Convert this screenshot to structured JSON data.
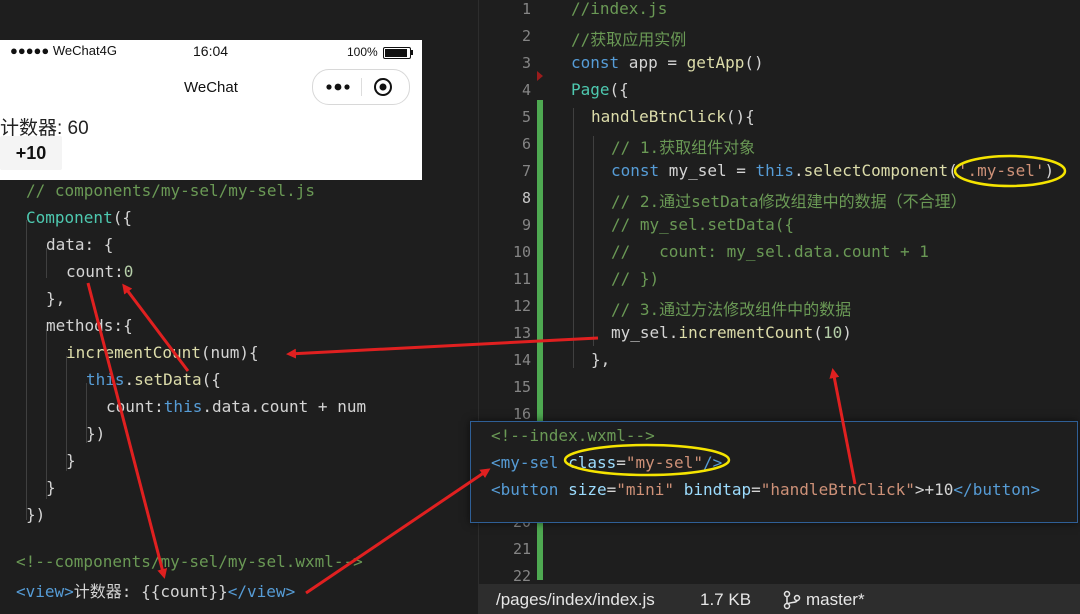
{
  "main_editor": {
    "line_numbers": [
      "1",
      "2",
      "3",
      "4",
      "5",
      "6",
      "7",
      "8",
      "9",
      "10",
      "11",
      "12",
      "13",
      "14",
      "15",
      "16",
      "",
      "",
      "",
      "20",
      "21",
      "22"
    ],
    "l1": "//index.js",
    "l2": "//获取应用实例",
    "l3_kw": "const",
    "l3_rest": " app = ",
    "l3_fn": "getApp",
    "l3_end": "()",
    "l4_a": "Page",
    "l4_b": "({",
    "l5_fn": "handleBtnClick",
    "l5_end": "(){",
    "l6": "// 1.获取组件对象",
    "l7_kw": "const",
    "l7_a": " my_sel = ",
    "l7_this": "this",
    "l7_b": ".",
    "l7_fn": "selectComponent",
    "l7_c": "(",
    "l7_str": "'.my-sel'",
    "l7_d": ")",
    "l8": "// 2.通过setData修改组建中的数据（不合理）",
    "l9": "// my_sel.setData({",
    "l10": "//   count: my_sel.data.count + 1",
    "l11": "// })",
    "l12": "// 3.通过方法修改组件中的数据",
    "l13_a": "my_sel.",
    "l13_fn": "incrementCount",
    "l13_b": "(",
    "l13_num": "10",
    "l13_c": ")",
    "l14": "},"
  },
  "status_bar": {
    "path": "/pages/index/index.js",
    "size": "1.7 KB",
    "branch": "master*"
  },
  "phone": {
    "carrier": "●●●●● WeChat4G",
    "time": "16:04",
    "battery": "100%",
    "nav_title": "WeChat",
    "counter_text": "计数器: 60",
    "button_label": "+10"
  },
  "component_js": {
    "l1": "// components/my-sel/my-sel.js",
    "l2_a": "Component",
    "l2_b": "({",
    "l3": "data: {",
    "l4_a": "count:",
    "l4_b": "0",
    "l5": "},",
    "l6": "methods:{",
    "l7_fn": "incrementCount",
    "l7_b": "(num){",
    "l8_this": "this",
    "l8_a": ".",
    "l8_fn": "setData",
    "l8_b": "({",
    "l9_a": "count:",
    "l9_this": "this",
    "l9_b": ".data.count + num",
    "l10": "})",
    "l11": "}",
    "l12": "}",
    "l13": "})"
  },
  "component_wxml": {
    "l1": "<!--components/my-sel/my-sel.wxml-->",
    "l2_open": "<view>",
    "l2_text": "计数器: {{count}}",
    "l2_close": "</view>"
  },
  "index_wxml": {
    "l1": "<!--index.wxml-->",
    "l2_tag": "<my-sel",
    "l2_attr": "class",
    "l2_eq": "=",
    "l2_val": "\"my-sel\"",
    "l2_end": "/>",
    "l3_tag": "<button",
    "l3_attr1": "size",
    "l3_val1": "\"mini\"",
    "l3_attr2": "bindtap",
    "l3_val2": "\"handleBtnClick\"",
    "l3_text": ">+10",
    "l3_close": "</button>"
  },
  "colors": {
    "comment": "#6a9955",
    "keyword": "#569cd6",
    "function": "#dcdcaa",
    "string": "#ce9178",
    "annotation": "#e02020",
    "highlight": "#f5e400"
  }
}
